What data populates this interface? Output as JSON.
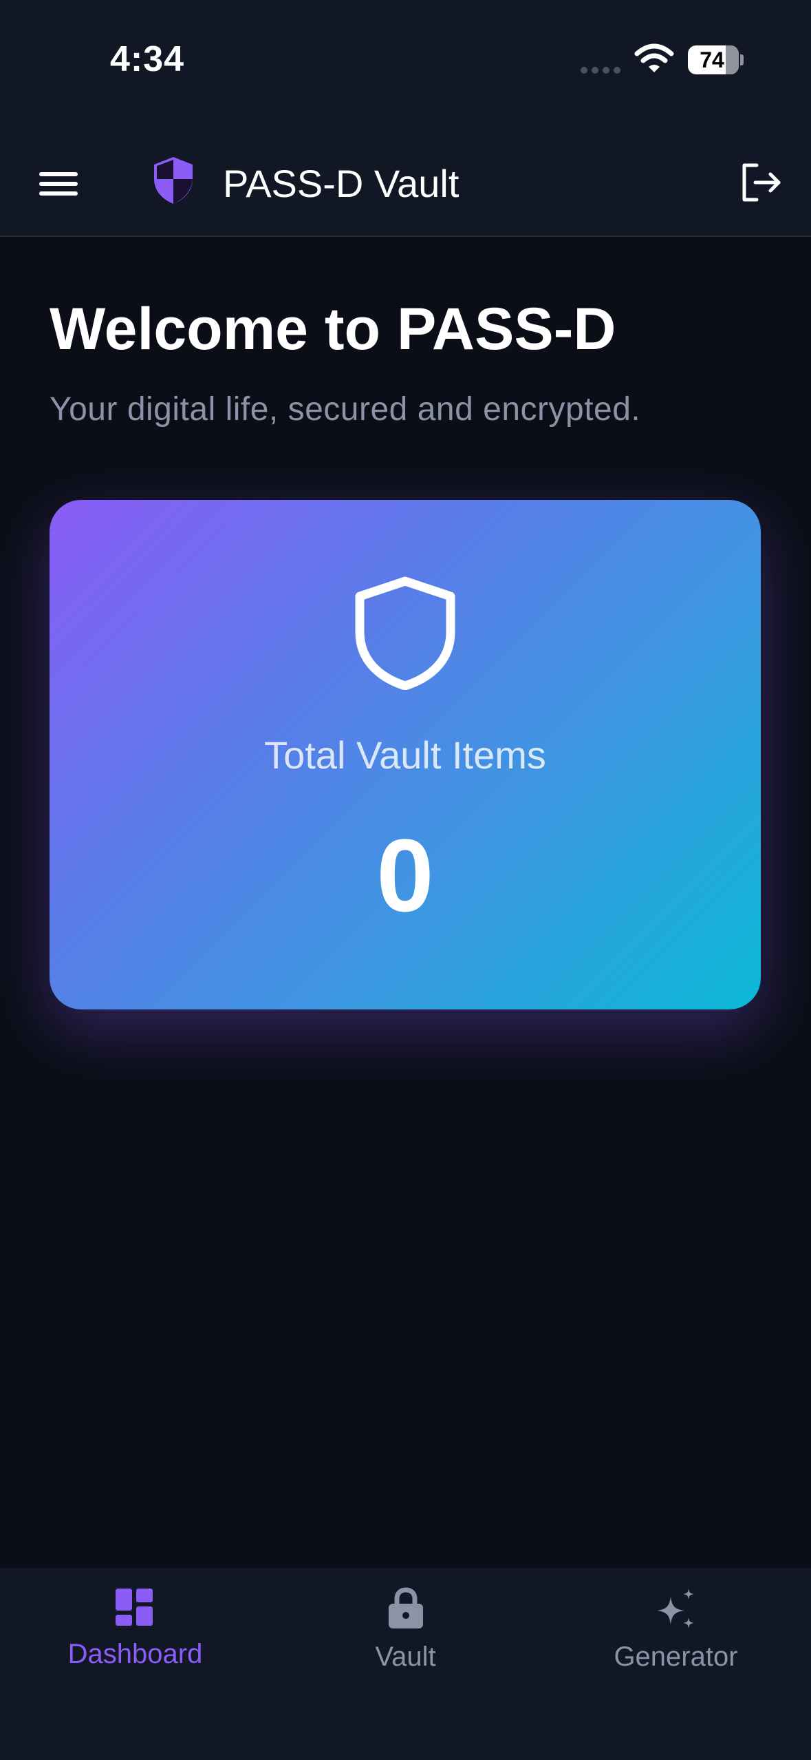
{
  "status_bar": {
    "time": "4:34",
    "battery_level": "74",
    "battery_fraction": 0.74
  },
  "header": {
    "title": "PASS-D Vault",
    "icons": {
      "menu": "menu-icon",
      "logo": "shield-half-icon",
      "logout": "logout-icon"
    }
  },
  "welcome": {
    "title": "Welcome to PASS-D",
    "subtitle": "Your digital life, secured and encrypted."
  },
  "stat_card": {
    "label": "Total Vault Items",
    "value": "0",
    "icon": "shield-outline-icon",
    "gradient": [
      "#8a5cf6",
      "#0bb8d6"
    ]
  },
  "bottom_nav": {
    "active": "Dashboard",
    "items": [
      {
        "label": "Dashboard",
        "icon": "dashboard-grid-icon",
        "color": "#8b5cf6"
      },
      {
        "label": "Vault",
        "icon": "lock-icon",
        "color": "#8b93a7"
      },
      {
        "label": "Generator",
        "icon": "sparkles-icon",
        "color": "#8b93a7"
      }
    ]
  },
  "colors": {
    "accent": "#8b5cf6",
    "background": "#0b0e17",
    "surface": "#111724",
    "muted_text": "#8b93a7"
  }
}
